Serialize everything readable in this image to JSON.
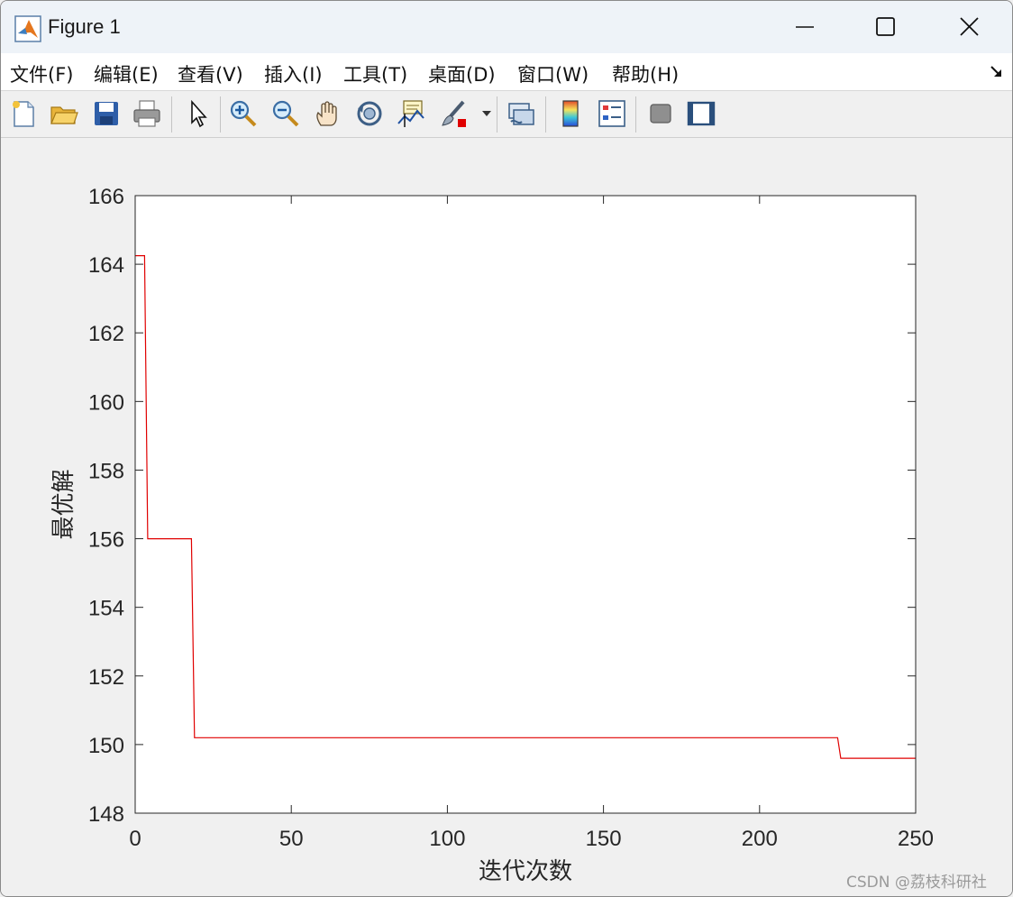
{
  "window": {
    "title": "Figure 1"
  },
  "menu": [
    {
      "label": "文件(F)"
    },
    {
      "label": "编辑(E)"
    },
    {
      "label": "查看(V)"
    },
    {
      "label": "插入(I)"
    },
    {
      "label": "工具(T)"
    },
    {
      "label": "桌面(D)"
    },
    {
      "label": "窗口(W)"
    },
    {
      "label": "帮助(H)"
    }
  ],
  "toolbar_icons": [
    "new-figure-icon",
    "open-folder-icon",
    "save-icon",
    "print-icon",
    "pointer-icon",
    "zoom-in-icon",
    "zoom-out-icon",
    "pan-hand-icon",
    "rotate-3d-icon",
    "data-cursor-icon",
    "brush-icon",
    "link-plot-icon",
    "colorbar-icon",
    "legend-icon",
    "hide-plot-tools-icon",
    "show-plot-tools-icon"
  ],
  "watermark": "CSDN @荔枝科研社",
  "chart_data": {
    "type": "line",
    "title": "",
    "xlabel": "迭代次数",
    "ylabel": "最优解",
    "xlim": [
      0,
      250
    ],
    "ylim": [
      148,
      166
    ],
    "xticks": [
      0,
      50,
      100,
      150,
      200,
      250
    ],
    "yticks": [
      148,
      150,
      152,
      154,
      156,
      158,
      160,
      162,
      164,
      166
    ],
    "grid": false,
    "series": [
      {
        "color": "#e00000",
        "x": [
          0,
          3,
          4,
          5,
          18,
          19,
          225,
          226,
          250
        ],
        "y": [
          164.25,
          164.25,
          156.0,
          156.0,
          156.0,
          150.2,
          150.2,
          149.6,
          149.6
        ]
      }
    ]
  }
}
